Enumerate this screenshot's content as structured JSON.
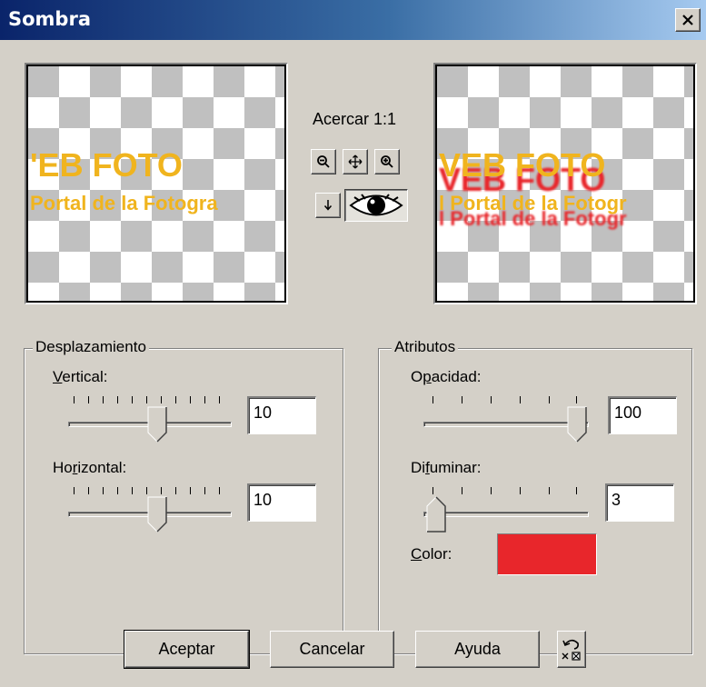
{
  "window": {
    "title": "Sombra"
  },
  "preview": {
    "line1_left": "'EB FOTO",
    "line2_left": "Portal de la Fotogra",
    "line1_right": "VEB FOTO",
    "line2_right": "l Portal de la Fotogr"
  },
  "zoom": {
    "label": "Acercar 1:1"
  },
  "tools": [
    "zoom-out-icon",
    "pan-icon",
    "zoom-in-icon",
    "hand-icon",
    "eye-icon"
  ],
  "desplazamiento": {
    "legend": "Desplazamiento",
    "vertical_label": "Vertical:",
    "vertical_value": "10",
    "horizontal_label": "Horizontal:",
    "horizontal_value": "10",
    "slider_level_fraction": 0.55
  },
  "atributos": {
    "legend": "Atributos",
    "opacidad_label": "Opacidad:",
    "opacidad_value": "100",
    "difuminar_label": "Difuminar:",
    "difuminar_value": "3",
    "color_label": "Color:",
    "color_value": "#e8262b"
  },
  "buttons": {
    "ok": "Aceptar",
    "cancel": "Cancelar",
    "help": "Ayuda"
  },
  "colors": {
    "title_start": "#0a246a",
    "title_end": "#a6caf0",
    "text_yellow": "#f0b41e",
    "shadow_red": "#e8262b"
  }
}
